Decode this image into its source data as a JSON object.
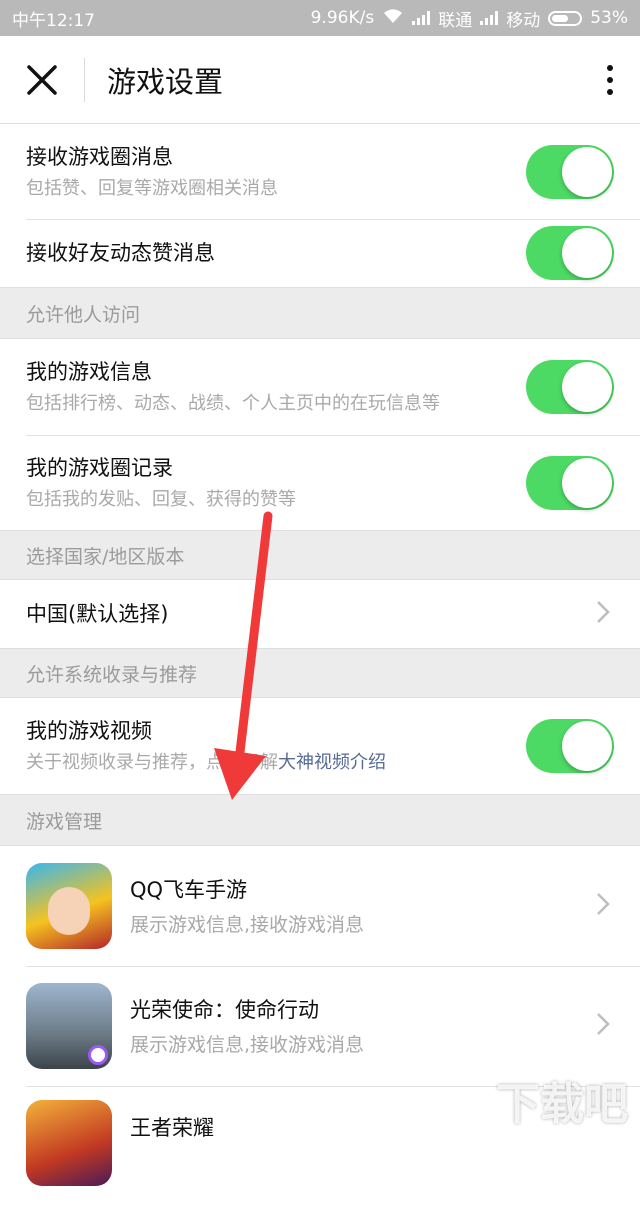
{
  "status_bar": {
    "time": "中午12:17",
    "speed": "9.96K/s",
    "carrier1": "联通",
    "carrier2": "移动",
    "battery": "53%"
  },
  "header": {
    "close_icon": "close-icon",
    "title": "游戏设置",
    "more_icon": "more-vertical-icon"
  },
  "rows_top": [
    {
      "main": "接收游戏圈消息",
      "sub": "包括赞、回复等游戏圈相关消息",
      "on": true
    },
    {
      "main": "接收好友动态赞消息",
      "on": true
    }
  ],
  "sections": {
    "visit": "允许他人访问",
    "region": "选择国家/地区版本",
    "record": "允许系统收录与推荐",
    "manage": "游戏管理"
  },
  "rows_visit": [
    {
      "main": "我的游戏信息",
      "sub": "包括排行榜、动态、战绩、个人主页中的在玩信息等",
      "on": true
    },
    {
      "main": "我的游戏圈记录",
      "sub": "包括我的发贴、回复、获得的赞等",
      "on": true
    }
  ],
  "region_value": "中国(默认选择)",
  "video_row": {
    "main": "我的游戏视频",
    "sub_prefix": "关于视频收录与推荐，点击了解",
    "sub_link": "大神视频介绍",
    "on": true
  },
  "games": [
    {
      "name": "QQ飞车手游",
      "desc": "展示游戏信息,接收游戏消息"
    },
    {
      "name": "光荣使命：使命行动",
      "desc": "展示游戏信息,接收游戏消息"
    },
    {
      "name": "王者荣耀"
    }
  ],
  "colors": {
    "toggle_on": "#4cd964",
    "link": "#576b95",
    "arrow": "#f03a3a"
  }
}
